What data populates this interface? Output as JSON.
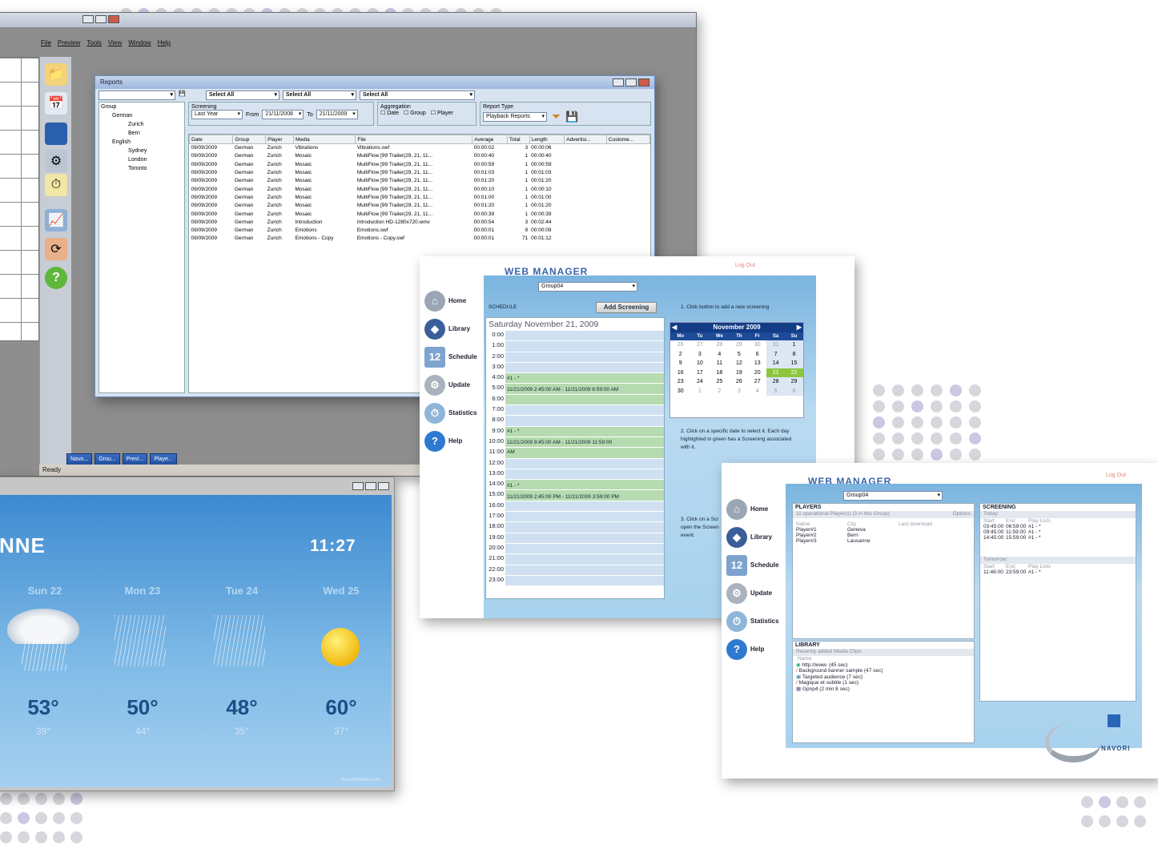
{
  "app": {
    "menu": [
      "File",
      "Preview",
      "Tools",
      "View",
      "Window",
      "Help"
    ],
    "status": "Ready",
    "tasks": [
      "Navo...",
      "Grou...",
      "Previ...",
      "Playe..."
    ]
  },
  "reports": {
    "title": "Reports",
    "selects": [
      "Select All",
      "Select All",
      "Select All"
    ],
    "tree": [
      "Group",
      "German",
      "Zurich",
      "Bern",
      "English",
      "Sydney",
      "London",
      "Toronto"
    ],
    "screening_label": "Screening",
    "screening": "Last Year",
    "from_label": "From",
    "from": "21/11/2008",
    "to_label": "To",
    "to": "21/11/2009",
    "aggregation_label": "Aggregation",
    "agg": [
      "Date",
      "Group",
      "Player"
    ],
    "report_type_label": "Report Type",
    "report_type": "Playback Reports",
    "columns": [
      "Date",
      "Group",
      "Player",
      "Media",
      "File",
      "Average",
      "Total",
      "Length",
      "Advertisi...",
      "Custome..."
    ],
    "rows": [
      [
        "09/09/2009",
        "German",
        "Zurich",
        "Vibrations",
        "Vibrations.swf",
        "00:00:02",
        "3",
        "00:00:06"
      ],
      [
        "09/09/2009",
        "German",
        "Zurich",
        "Mosaic",
        "MultiFlow [99 Trailer(29, 21, 11...",
        "00:00:40",
        "1",
        "00:00:40"
      ],
      [
        "09/09/2009",
        "German",
        "Zurich",
        "Mosaic",
        "MultiFlow [99 Trailer(29, 21, 11...",
        "00:00:59",
        "1",
        "00:00:59"
      ],
      [
        "09/09/2009",
        "German",
        "Zurich",
        "Mosaic",
        "MultiFlow [99 Trailer(29, 21, 11...",
        "00:01:03",
        "1",
        "00:01:03"
      ],
      [
        "09/09/2009",
        "German",
        "Zurich",
        "Mosaic",
        "MultiFlow [99 Trailer(29, 21, 11...",
        "00:01:20",
        "1",
        "00:01:20"
      ],
      [
        "09/09/2009",
        "German",
        "Zurich",
        "Mosaic",
        "MultiFlow [99 Trailer(29, 21, 11...",
        "00:00:10",
        "1",
        "00:00:10"
      ],
      [
        "09/09/2009",
        "German",
        "Zurich",
        "Mosaic",
        "MultiFlow [99 Trailer(29, 21, 11...",
        "00:01:00",
        "1",
        "00:01:00"
      ],
      [
        "09/09/2009",
        "German",
        "Zurich",
        "Mosaic",
        "MultiFlow [99 Trailer(29, 21, 11...",
        "00:01:20",
        "1",
        "00:01:20"
      ],
      [
        "09/09/2009",
        "German",
        "Zurich",
        "Mosaic",
        "MultiFlow [99 Trailer(29, 21, 11...",
        "00:00:39",
        "1",
        "00:00:39"
      ],
      [
        "09/09/2009",
        "German",
        "Zurich",
        "Introduction",
        "Introduction HD-1280x720.wmv",
        "00:00:54",
        "3",
        "00:02:44"
      ],
      [
        "09/09/2009",
        "German",
        "Zurich",
        "Emotions",
        "Emotions.swf",
        "00:00:01",
        "9",
        "00:00:09"
      ],
      [
        "09/09/2009",
        "German",
        "Zurich",
        "Emotions - Copy",
        "Emotions - Copy.swf",
        "00:00:01",
        "71",
        "00:01:12"
      ]
    ]
  },
  "wm1": {
    "header": "WEB MANAGER",
    "logout": "Log Out",
    "group": "Group04",
    "schedule_label": "SCHEDULE",
    "add_button": "Add Screening",
    "date": "Saturday November 21, 2009",
    "step1": "1. Click button to add a new screening",
    "step2": "2. Click on a specific date to select it. Each day highlighted in green has a Screening associated with it.",
    "step3": "3. Click on a Scr open the Screen event.",
    "nav": [
      "Home",
      "Library",
      "Schedule",
      "Update",
      "Statistics",
      "Help"
    ],
    "hours": [
      "0:00",
      "1:00",
      "2:00",
      "3:00",
      "4:00",
      "5:00",
      "6:00",
      "7:00",
      "8:00",
      "9:00",
      "10:00",
      "11:00",
      "12:00",
      "13:00",
      "14:00",
      "15:00",
      "16:00",
      "17:00",
      "18:00",
      "19:00",
      "20:00",
      "21:00",
      "22:00",
      "23:00"
    ],
    "events": [
      "#1 - *",
      "11/21/2009 2:45:00 AM - 11/21/2009 6:59:00 AM",
      "#1 - *",
      "11/21/2009 9:45:00 AM - 11/21/2009 11:59:00",
      "AM",
      "#1 - *",
      "11/21/2009 2:45:00 PM - 11/21/2009 3:59:00 PM"
    ],
    "month": "November 2009",
    "weekdays": [
      "Mo",
      "Tu",
      "We",
      "Th",
      "Fr",
      "Sa",
      "Su"
    ],
    "weeks": [
      [
        "26",
        "27",
        "28",
        "29",
        "30",
        "31",
        "1"
      ],
      [
        "2",
        "3",
        "4",
        "5",
        "6",
        "7",
        "8"
      ],
      [
        "9",
        "10",
        "11",
        "12",
        "13",
        "14",
        "15"
      ],
      [
        "16",
        "17",
        "18",
        "19",
        "20",
        "21",
        "22"
      ],
      [
        "23",
        "24",
        "25",
        "26",
        "27",
        "28",
        "29"
      ],
      [
        "30",
        "1",
        "2",
        "3",
        "4",
        "5",
        "6"
      ]
    ]
  },
  "wm2": {
    "header": "WEB MANAGER",
    "logout": "Log Out",
    "group": "Group04",
    "players_title": "PLAYERS",
    "players_sub": "11 operational Player(s) (3 in this Group)",
    "options": "Options",
    "player_cols": [
      "Name",
      "City",
      "Last download"
    ],
    "players": [
      [
        "Player#1",
        "Geneva"
      ],
      [
        "Player#2",
        "Bern"
      ],
      [
        "Player#3",
        "Lausanne"
      ]
    ],
    "screening_title": "SCREENING",
    "today": "Today:",
    "tomorrow": "Tomorrow:",
    "sc_cols": [
      "Start",
      "End",
      "Play Lists"
    ],
    "today_rows": [
      [
        "03:45:00",
        "06:59:00",
        "#1 - *"
      ],
      [
        "09:45:00",
        "11:59:00",
        "#1 - *"
      ],
      [
        "14:45:00",
        "15:59:00",
        "#1 - *"
      ]
    ],
    "tomorrow_rows": [
      [
        "11:46:00",
        "23:59:00",
        "#1 - *"
      ]
    ],
    "library_title": "LIBRARY",
    "library_sub": "Recently added Media Clips:",
    "lib_col": "Name",
    "library": [
      "http://www. (45 sec)",
      "Background banner sample (47 sec)",
      "Targeted audience (7 sec)",
      "Magique et subtile (1 sec)",
      "Gpnp4 (2 min 8 sec)"
    ],
    "nav": [
      "Home",
      "Library",
      "Schedule",
      "Update",
      "Statistics",
      "Help"
    ],
    "logo": "NAVORI"
  },
  "weather": {
    "city": "NNE",
    "time": "11:27",
    "days": [
      {
        "name": "Sun 22",
        "hi": "53°",
        "lo": "39°"
      },
      {
        "name": "Mon 23",
        "hi": "50°",
        "lo": "44°"
      },
      {
        "name": "Tue 24",
        "hi": "48°",
        "lo": "35°"
      },
      {
        "name": "Wed 25",
        "hi": "60°",
        "lo": "37°"
      }
    ],
    "credit": "AccuWeather.com"
  }
}
